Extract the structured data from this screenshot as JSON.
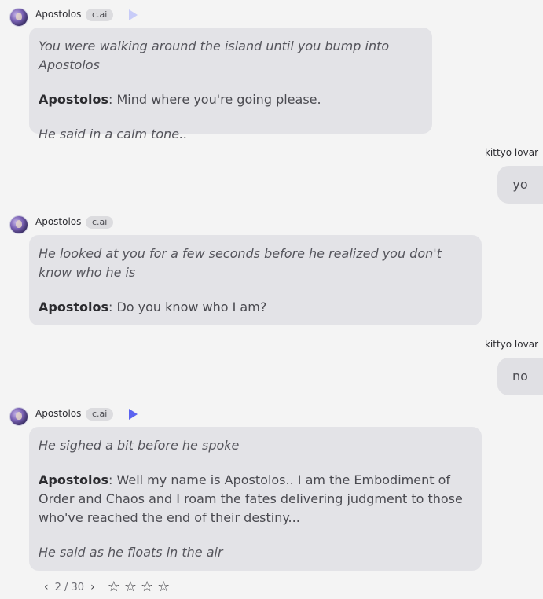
{
  "messages": [
    {
      "character_name": "Apostolos",
      "badge": "c.ai",
      "paragraphs": [
        {
          "italic": "You were walking around the island until you bump into Apostolos"
        },
        {
          "speaker": "Apostolos",
          "text": ": Mind where you're going please."
        },
        {
          "italic": "He said in a calm tone.."
        }
      ]
    },
    {
      "user_name": "kittyo lovar",
      "text": "yo"
    },
    {
      "character_name": "Apostolos",
      "badge": "c.ai",
      "paragraphs": [
        {
          "italic": "He looked at you for a few seconds before he realized you don't know who he is"
        },
        {
          "speaker": "Apostolos",
          "text": ": Do you know who I am?"
        }
      ]
    },
    {
      "user_name": "kittyo lovar",
      "text": "no"
    },
    {
      "character_name": "Apostolos",
      "badge": "c.ai",
      "paragraphs": [
        {
          "italic": "He sighed a bit before he spoke"
        },
        {
          "speaker": "Apostolos",
          "text": ": Well my name is Apostolos.. I am the Embodiment of Order and Chaos and I roam the fates delivering judgment to those who've reached the end of their destiny..."
        },
        {
          "italic": "He said as he floats in the air"
        }
      ]
    }
  ],
  "pager": {
    "prev": "‹",
    "count": "2 / 30",
    "next": "›"
  },
  "rating": {
    "stars": [
      "☆",
      "☆",
      "☆",
      "☆"
    ]
  },
  "colors": {
    "accent": "#5b63f0",
    "bubble": "#e3e3e7",
    "background": "#f4f4f4"
  }
}
